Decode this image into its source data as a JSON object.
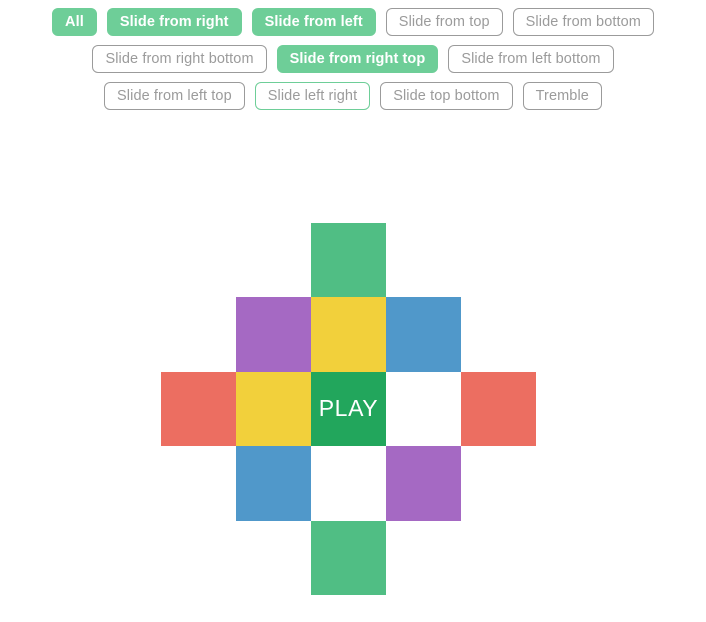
{
  "filter_bar": {
    "rows": [
      [
        {
          "label": "All",
          "state": "active"
        },
        {
          "label": "Slide from right",
          "state": "active"
        },
        {
          "label": "Slide from left",
          "state": "active"
        },
        {
          "label": "Slide from top",
          "state": "default"
        },
        {
          "label": "Slide from bottom",
          "state": "default"
        }
      ],
      [
        {
          "label": "Slide from right bottom",
          "state": "default"
        },
        {
          "label": "Slide from right top",
          "state": "active"
        },
        {
          "label": "Slide from left bottom",
          "state": "default"
        }
      ],
      [
        {
          "label": "Slide from left top",
          "state": "default"
        },
        {
          "label": "Slide left right",
          "state": "hover"
        },
        {
          "label": "Slide top bottom",
          "state": "default"
        },
        {
          "label": "Tremble",
          "state": "default"
        }
      ]
    ]
  },
  "colors": {
    "button_green": "#6ece98",
    "button_border_gray": "#9b9b9b",
    "button_text_gray": "#9b9b9b",
    "tile_green_light": "#50be84",
    "tile_green_dark": "#22a65c",
    "tile_purple": "#a569c3",
    "tile_yellow": "#f2d03b",
    "tile_blue": "#5098ca",
    "tile_red": "#ec6e61",
    "tile_white": "#ffffff",
    "page_background": "#ffffff"
  },
  "tile_grid": {
    "columns": 5,
    "rows": 5,
    "play_label": "PLAY",
    "cells": [
      {
        "color": "",
        "empty": true,
        "label": ""
      },
      {
        "color": "",
        "empty": true,
        "label": ""
      },
      {
        "color": "#50be84",
        "empty": false,
        "label": ""
      },
      {
        "color": "",
        "empty": true,
        "label": ""
      },
      {
        "color": "",
        "empty": true,
        "label": ""
      },
      {
        "color": "",
        "empty": true,
        "label": ""
      },
      {
        "color": "#a569c3",
        "empty": false,
        "label": ""
      },
      {
        "color": "#f2d03b",
        "empty": false,
        "label": ""
      },
      {
        "color": "#5098ca",
        "empty": false,
        "label": ""
      },
      {
        "color": "",
        "empty": true,
        "label": ""
      },
      {
        "color": "#ec6e61",
        "empty": false,
        "label": ""
      },
      {
        "color": "#f2d03b",
        "empty": false,
        "label": ""
      },
      {
        "color": "#22a65c",
        "empty": false,
        "label": "PLAY"
      },
      {
        "color": "#ffffff",
        "empty": false,
        "label": ""
      },
      {
        "color": "#ec6e61",
        "empty": false,
        "label": ""
      },
      {
        "color": "",
        "empty": true,
        "label": ""
      },
      {
        "color": "#5098ca",
        "empty": false,
        "label": ""
      },
      {
        "color": "#ffffff",
        "empty": false,
        "label": ""
      },
      {
        "color": "#a569c3",
        "empty": false,
        "label": ""
      },
      {
        "color": "",
        "empty": true,
        "label": ""
      },
      {
        "color": "",
        "empty": true,
        "label": ""
      },
      {
        "color": "",
        "empty": true,
        "label": ""
      },
      {
        "color": "#50be84",
        "empty": false,
        "label": ""
      },
      {
        "color": "",
        "empty": true,
        "label": ""
      },
      {
        "color": "",
        "empty": true,
        "label": ""
      }
    ]
  }
}
